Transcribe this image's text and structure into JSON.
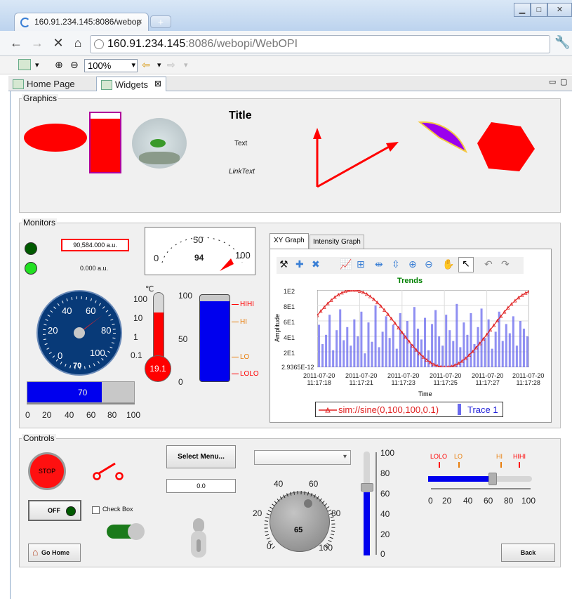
{
  "browser": {
    "tab_title": "160.91.234.145:8086/webop",
    "close_glyph": "×",
    "new_tab_glyph": "+",
    "url_host": "160.91.234.145",
    "url_rest": ":8086/webopi/WebOPI",
    "zoom": "100%"
  },
  "editor_tabs": {
    "home": "Home Page",
    "widgets": "Widgets"
  },
  "graphics": {
    "label": "Graphics",
    "title": "Title",
    "text": "Text",
    "link": "LinkText"
  },
  "monitors": {
    "label": "Monitors",
    "readback1": "90,584.000 a.u.",
    "readback2": "0.000 a.u.",
    "meter": {
      "ticks": [
        "0",
        "50",
        "100"
      ],
      "value": "94"
    },
    "gauge": {
      "ticks": [
        "0",
        "20",
        "40",
        "60",
        "80",
        "100"
      ],
      "value": "70"
    },
    "thermo": {
      "unit": "℃",
      "ticks": [
        "100",
        "10",
        "1",
        "0.1"
      ],
      "value": "19.1"
    },
    "tank": {
      "ticks": [
        "100",
        "50",
        "0"
      ],
      "markers": [
        "HIHI",
        "HI",
        "LO",
        "LOLO"
      ]
    },
    "progress": {
      "value": "70",
      "fraction": 0.7,
      "ticks": [
        "0",
        "20",
        "40",
        "60",
        "80",
        "100"
      ]
    },
    "graph_tabs": [
      "XY Graph",
      "Intensity Graph"
    ]
  },
  "chart_data": {
    "type": "line",
    "title": "Trends",
    "xlabel": "Time",
    "ylabel": "Amplitude",
    "y_ticks": [
      "1E2",
      "8E1",
      "6E1",
      "4E1",
      "2E1",
      "2.9365E-12"
    ],
    "x_ticks": [
      [
        "2011-07-20",
        "11:17:18"
      ],
      [
        "2011-07-20",
        "11:17:21"
      ],
      [
        "2011-07-20",
        "11:17:23"
      ],
      [
        "2011-07-20",
        "11:17:25"
      ],
      [
        "2011-07-20",
        "11:17:27"
      ],
      [
        "2011-07-20",
        "11:17:28"
      ]
    ],
    "ylim": [
      0,
      100
    ],
    "series": [
      {
        "name": "sim://sine(0,100,100,0.1)",
        "color": "#e02020",
        "kind": "line"
      },
      {
        "name": "Trace 1",
        "color": "#6a6aee",
        "kind": "bar",
        "values": [
          55,
          30,
          42,
          68,
          22,
          48,
          75,
          35,
          52,
          28,
          62,
          40,
          72,
          18,
          58,
          33,
          80,
          26,
          46,
          66,
          38,
          55,
          24,
          70,
          44,
          60,
          30,
          78,
          50,
          36,
          64,
          22,
          56,
          74,
          40,
          28,
          68,
          48,
          34,
          82,
          26,
          58,
          42,
          70,
          30,
          52,
          76,
          38,
          62,
          24,
          46,
          72,
          34,
          56,
          44,
          66,
          28,
          60,
          50,
          40
        ]
      }
    ],
    "legend": "bottom",
    "grid": true
  },
  "controls": {
    "label": "Controls",
    "stop": "STOP",
    "off": "OFF",
    "checkbox": "Check Box",
    "go_home": "Go Home",
    "select_menu": "Select Menu...",
    "spinner": "0.0",
    "knob": {
      "ticks": [
        "0",
        "20",
        "40",
        "60",
        "80",
        "100"
      ],
      "value": "65"
    },
    "vslider": {
      "ticks": [
        "100",
        "80",
        "60",
        "40",
        "20",
        "0"
      ]
    },
    "hslider": {
      "markers": [
        "LOLO",
        "LO",
        "HI",
        "HIHI"
      ],
      "ticks": [
        "0",
        "20",
        "40",
        "60",
        "80",
        "100"
      ],
      "fraction": 0.62
    },
    "back": "Back"
  },
  "colors": {
    "alarm_red": "#ff0000",
    "hi_orange": "#e87e0c",
    "tank_blue": "#0000ee",
    "gauge_navy": "#083a78"
  }
}
